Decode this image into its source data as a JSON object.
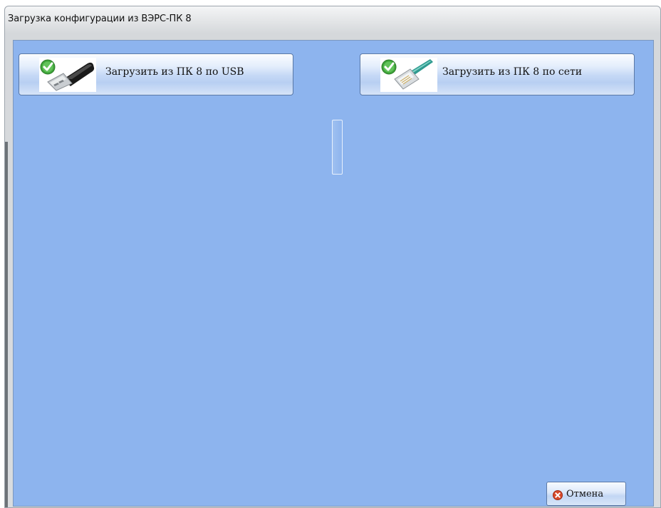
{
  "window": {
    "title": "Загрузка конфигурации из ВЭРС-ПК 8"
  },
  "actions": {
    "usb": {
      "label": "Загрузить из ПК 8 по USB",
      "icon": "usb-plug-icon"
    },
    "network": {
      "label": "Загрузить из ПК 8 по сети",
      "icon": "ethernet-plug-icon"
    }
  },
  "footer": {
    "cancel_label": "Отмена",
    "cancel_icon": "cancel-icon"
  },
  "colors": {
    "client_background": "#8db4ee",
    "button_border": "#5b79a6",
    "check_badge": "#3fa53a",
    "cancel_badge": "#d94a2b"
  }
}
